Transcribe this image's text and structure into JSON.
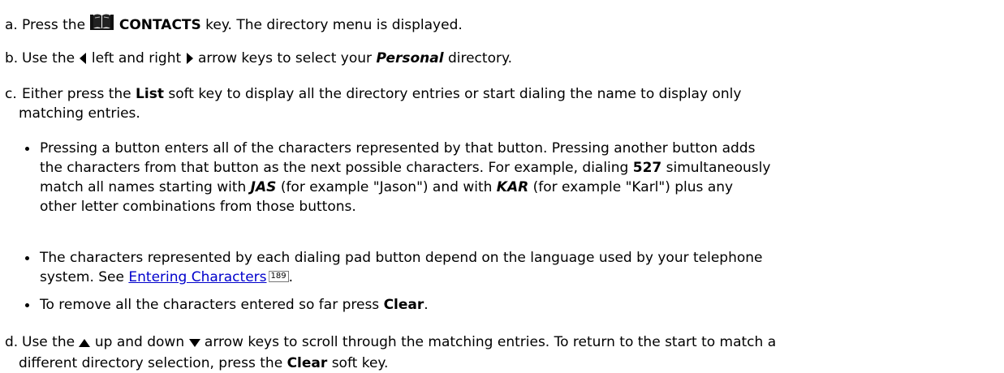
{
  "steps": {
    "a": {
      "label": "a.",
      "t1": "Press the",
      "key": "CONTACTS",
      "t2": "key. The directory menu is displayed.",
      "icon": "book-icon"
    },
    "b": {
      "label": "b.",
      "t1": "Use the",
      "t2": "left and right",
      "t3": "arrow keys to select your",
      "directory": "Personal",
      "t4": "directory."
    },
    "c": {
      "label": "c.",
      "t1": "Either press the",
      "softkey": "List",
      "t2": "soft key to display all the directory entries or start dialing the name to display only",
      "t3": "matching entries."
    },
    "d": {
      "label": "d.",
      "t1": "Use the",
      "t2": "up and down",
      "t3": "arrow keys to scroll through the matching entries. To return to the start to match a",
      "t4": "different directory selection, press the",
      "softkey": "Clear",
      "t5": "soft key."
    }
  },
  "bullets": {
    "b1": {
      "l1": "Pressing a button enters all of the characters represented by that button. Pressing another button adds",
      "l2a": "the characters from that button as the next possible characters. For example, dialing",
      "digits": "527",
      "l2b": "simultaneously",
      "l3a": "match all names starting with",
      "jas": "JAS",
      "l3b": "(for example \"Jason\") and with",
      "kar": "KAR",
      "l3c": "(for example \"Karl\") plus any",
      "l4": "other letter combinations from those buttons."
    },
    "b2": {
      "l1": "The characters represented by each dialing pad button depend on the language used by your telephone",
      "l2a": "system. See",
      "link": "Entering Characters",
      "page_ref": "189",
      "l2b": "."
    },
    "b3": {
      "t1": "To remove all the characters entered so far press",
      "key": "Clear",
      "t2": "."
    }
  }
}
